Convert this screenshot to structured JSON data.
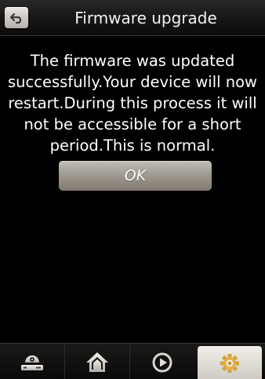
{
  "header": {
    "back_icon": "back-arrow-icon",
    "title": "Firmware upgrade"
  },
  "dialog": {
    "message": "The firmware was updated successfully.Your device will now restart.During this process it will not be accessible for a short period.This is normal.",
    "ok_label": "OK"
  },
  "nav": {
    "items": [
      {
        "icon": "device-icon",
        "active": false
      },
      {
        "icon": "home-icon",
        "active": false
      },
      {
        "icon": "play-icon",
        "active": false
      },
      {
        "icon": "gear-icon",
        "active": true
      }
    ]
  },
  "colors": {
    "background": "#000000",
    "button": "#a09a91",
    "active_tab": "#e6e2dc"
  }
}
